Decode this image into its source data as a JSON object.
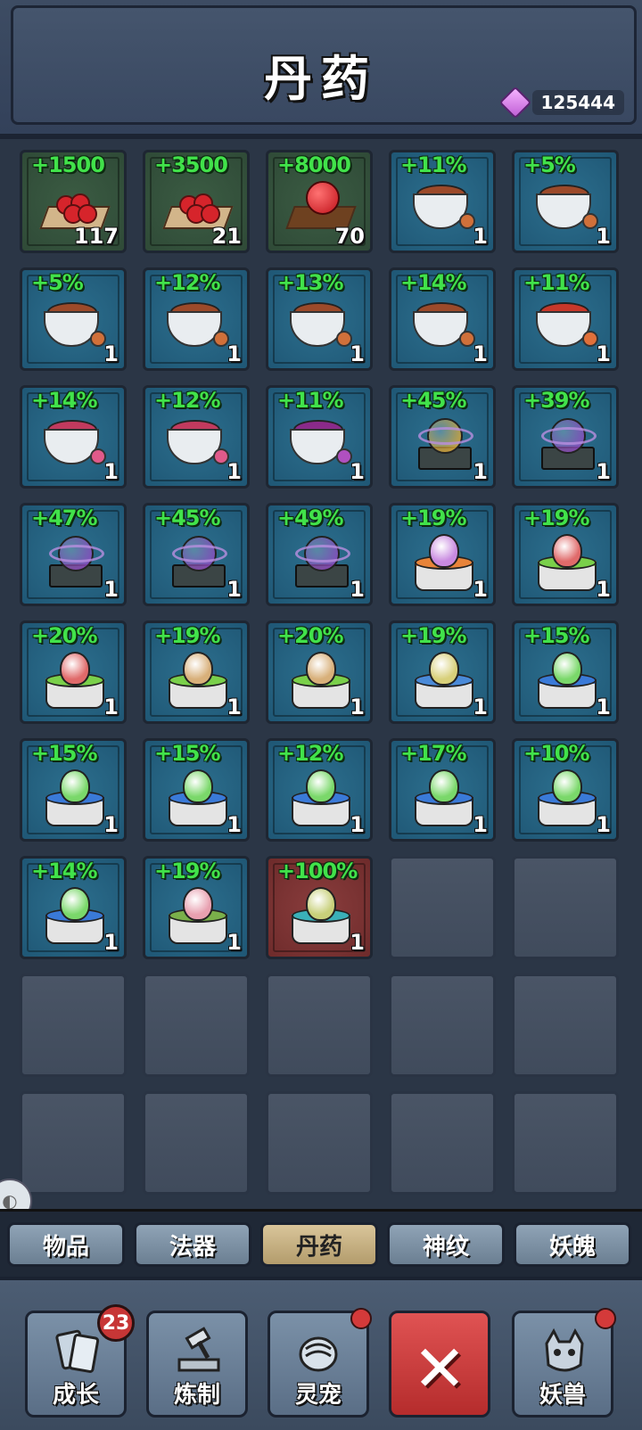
{
  "header": {
    "title": "丹药",
    "currency_value": "125444",
    "currency_icon": "gem-icon"
  },
  "grid": {
    "slots": [
      {
        "bonus": "+1500",
        "count": "117",
        "icon": "tray-pills",
        "bg": "green"
      },
      {
        "bonus": "+3500",
        "count": "21",
        "icon": "tray-pills",
        "bg": "green"
      },
      {
        "bonus": "+8000",
        "count": "70",
        "icon": "tray-big-pill",
        "bg": "green"
      },
      {
        "bonus": "+11%",
        "count": "1",
        "icon": "cup-brown",
        "bg": "blue"
      },
      {
        "bonus": "+5%",
        "count": "1",
        "icon": "cup-brown",
        "bg": "blue"
      },
      {
        "bonus": "+5%",
        "count": "1",
        "icon": "cup-brown",
        "bg": "blue"
      },
      {
        "bonus": "+12%",
        "count": "1",
        "icon": "cup-brown",
        "bg": "blue"
      },
      {
        "bonus": "+13%",
        "count": "1",
        "icon": "cup-brown",
        "bg": "blue"
      },
      {
        "bonus": "+14%",
        "count": "1",
        "icon": "cup-brown",
        "bg": "blue"
      },
      {
        "bonus": "+11%",
        "count": "1",
        "icon": "cup-red",
        "bg": "blue"
      },
      {
        "bonus": "+14%",
        "count": "1",
        "icon": "cup-pink",
        "bg": "blue"
      },
      {
        "bonus": "+12%",
        "count": "1",
        "icon": "cup-pink",
        "bg": "blue"
      },
      {
        "bonus": "+11%",
        "count": "1",
        "icon": "cup-purple",
        "bg": "blue"
      },
      {
        "bonus": "+45%",
        "count": "1",
        "icon": "brazier-gold",
        "bg": "blue"
      },
      {
        "bonus": "+39%",
        "count": "1",
        "icon": "brazier-purple",
        "bg": "blue"
      },
      {
        "bonus": "+47%",
        "count": "1",
        "icon": "brazier-purple",
        "bg": "blue"
      },
      {
        "bonus": "+45%",
        "count": "1",
        "icon": "brazier-purple",
        "bg": "blue"
      },
      {
        "bonus": "+49%",
        "count": "1",
        "icon": "brazier-purple",
        "bg": "blue"
      },
      {
        "bonus": "+19%",
        "count": "1",
        "icon": "egg-purple-orange",
        "bg": "blue"
      },
      {
        "bonus": "+19%",
        "count": "1",
        "icon": "egg-red-green",
        "bg": "blue"
      },
      {
        "bonus": "+20%",
        "count": "1",
        "icon": "egg-red-green",
        "bg": "blue"
      },
      {
        "bonus": "+19%",
        "count": "1",
        "icon": "egg-tan-green",
        "bg": "blue"
      },
      {
        "bonus": "+20%",
        "count": "1",
        "icon": "egg-tan-green",
        "bg": "blue"
      },
      {
        "bonus": "+19%",
        "count": "1",
        "icon": "egg-yellow-blue",
        "bg": "blue"
      },
      {
        "bonus": "+15%",
        "count": "1",
        "icon": "egg-green-blue",
        "bg": "blue"
      },
      {
        "bonus": "+15%",
        "count": "1",
        "icon": "egg-green-blue",
        "bg": "blue"
      },
      {
        "bonus": "+15%",
        "count": "1",
        "icon": "egg-green-blue",
        "bg": "blue"
      },
      {
        "bonus": "+12%",
        "count": "1",
        "icon": "egg-green-blue",
        "bg": "blue"
      },
      {
        "bonus": "+17%",
        "count": "1",
        "icon": "egg-green-blue",
        "bg": "blue"
      },
      {
        "bonus": "+10%",
        "count": "1",
        "icon": "egg-green-blue",
        "bg": "blue"
      },
      {
        "bonus": "+14%",
        "count": "1",
        "icon": "egg-green-blue",
        "bg": "blue"
      },
      {
        "bonus": "+19%",
        "count": "1",
        "icon": "egg-pink-green",
        "bg": "blue"
      },
      {
        "bonus": "+100%",
        "count": "1",
        "icon": "egg-yellow-teal",
        "bg": "red"
      },
      {
        "empty": true
      },
      {
        "empty": true
      },
      {
        "empty": true
      },
      {
        "empty": true
      },
      {
        "empty": true
      },
      {
        "empty": true
      },
      {
        "empty": true
      },
      {
        "empty": true
      },
      {
        "empty": true
      },
      {
        "empty": true
      },
      {
        "empty": true
      },
      {
        "empty": true
      }
    ]
  },
  "tabs": [
    {
      "label": "物品",
      "active": false
    },
    {
      "label": "法器",
      "active": false
    },
    {
      "label": "丹药",
      "active": true
    },
    {
      "label": "神纹",
      "active": false
    },
    {
      "label": "妖魄",
      "active": false
    }
  ],
  "bottom_nav": [
    {
      "label": "成长",
      "icon": "cards-icon",
      "badge": "23"
    },
    {
      "label": "炼制",
      "icon": "anvil-hammer-icon"
    },
    {
      "label": "灵宠",
      "icon": "pet-icon",
      "dot": true
    },
    {
      "label": "",
      "icon": "close-icon",
      "close": true
    },
    {
      "label": "妖兽",
      "icon": "beast-icon",
      "dot": true
    }
  ],
  "colors": {
    "bonus_text": "#41e24a",
    "active_tab": "#d9c59a",
    "close_button": "#d94444"
  }
}
